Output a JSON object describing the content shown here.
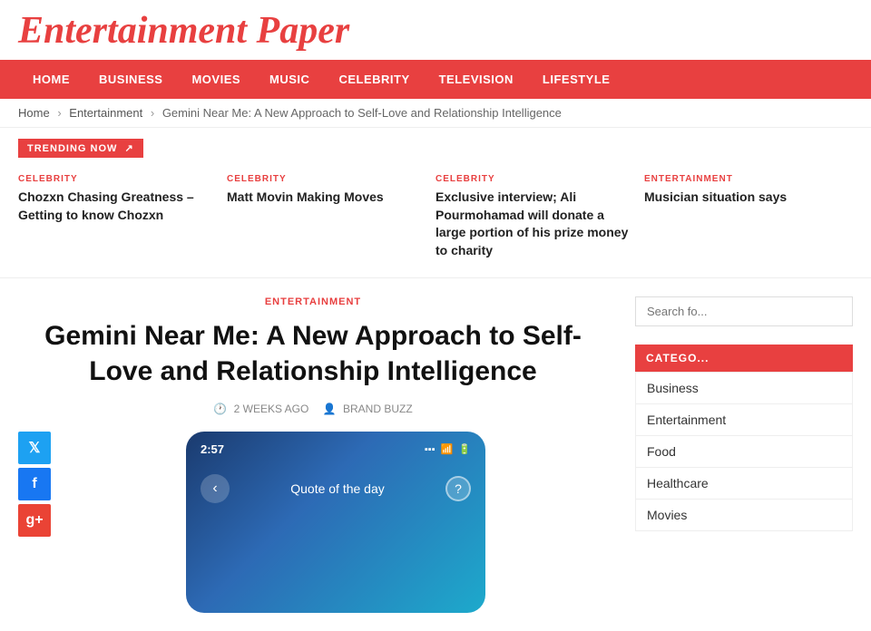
{
  "site": {
    "title": "Entertainment Paper"
  },
  "nav": {
    "items": [
      {
        "label": "HOME",
        "href": "#"
      },
      {
        "label": "BUSINESS",
        "href": "#"
      },
      {
        "label": "MOVIES",
        "href": "#"
      },
      {
        "label": "MUSIC",
        "href": "#"
      },
      {
        "label": "CELEBRITY",
        "href": "#"
      },
      {
        "label": "TELEVISION",
        "href": "#"
      },
      {
        "label": "LIFESTYLE",
        "href": "#"
      }
    ]
  },
  "breadcrumb": {
    "home": "Home",
    "parent": "Entertainment",
    "current": "Gemini Near Me: A New Approach to Self-Love and Relationship Intelligence"
  },
  "trending": {
    "label": "TRENDING NOW",
    "arrow": "↗",
    "items": [
      {
        "category": "CELEBRITY",
        "title": "Chozxn Chasing Greatness – Getting to know Chozxn"
      },
      {
        "category": "CELEBRITY",
        "title": "Matt Movin Making Moves"
      },
      {
        "category": "CELEBRITY",
        "title": "Exclusive interview; Ali Pourmohamad will donate a large portion of his prize money to charity"
      },
      {
        "category": "ENTERTAINMENT",
        "title": "Musician situation says"
      }
    ]
  },
  "article": {
    "category": "ENTERTAINMENT",
    "title": "Gemini Near Me: A New Approach to Self-Love and Relationship Intelligence",
    "meta_time": "2 WEEKS AGO",
    "meta_author": "BRAND BUZZ"
  },
  "phone_mockup": {
    "time": "2:57",
    "quote_label": "Quote of the day"
  },
  "social": {
    "twitter_icon": "𝕏",
    "facebook_icon": "f",
    "google_icon": "g+"
  },
  "sidebar": {
    "search_placeholder": "Search fo...",
    "categories_title": "CATEGO...",
    "categories": [
      "Business",
      "Entertainment",
      "Food",
      "Healthcare",
      "Movies"
    ]
  }
}
